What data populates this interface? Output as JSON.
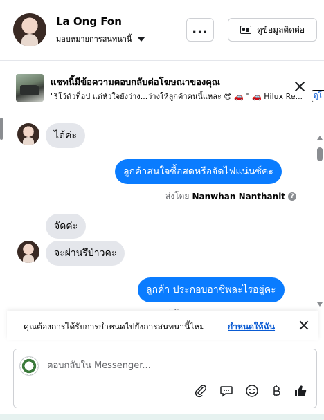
{
  "header": {
    "contact_name": "La Ong Fon",
    "assign_label": "มอบหมายการสนทนานี้",
    "more_label": "...",
    "contact_info_label": "ดูข้อมูลติดต่อ"
  },
  "ad_banner": {
    "title": "แชทนี้มีข้อความตอบกลับต่อโฆษณาของคุณ",
    "snippet": "\"รีโว้ตัวท็อป แต่หัวใจยังว่าง...ว่างให้ลูกค้าคนนี้แหละ 😎 🚗 \" 🚗 Hilux Re...",
    "button_label": "ดูโ"
  },
  "messages": [
    {
      "direction": "in",
      "text": "ได้ค่ะ"
    },
    {
      "direction": "out",
      "text": "ลูกค้าสนใจซื้อสดหรือจัดไฟแน่นซ์คะ"
    },
    {
      "direction": "in",
      "text": "จัดค่ะ"
    },
    {
      "direction": "in",
      "text": "จะผ่านรึป่าวคะ"
    },
    {
      "direction": "out",
      "text": "ลูกค้า ประกอบอาชีพละไรอยู่คะ"
    }
  ],
  "sent_by": {
    "prefix": "ส่งโดย",
    "name": "Nanwhan Nanthanit",
    "help": "?"
  },
  "notice": {
    "text": "คุณต้องการได้รับการกำหนดไปยังการสนทนานี้ไหม",
    "link": "กำหนดให้ฉัน"
  },
  "composer": {
    "placeholder": "ตอบกลับใน Messenger...",
    "tools": [
      "paperclip-icon",
      "quick-reply-icon",
      "emoji-icon",
      "baht-payment-icon",
      "thumbs-up-icon"
    ]
  },
  "colors": {
    "outgoing_bubble": "#0a7cff",
    "incoming_bubble": "#e4e6eb",
    "link": "#0a5bd3"
  }
}
